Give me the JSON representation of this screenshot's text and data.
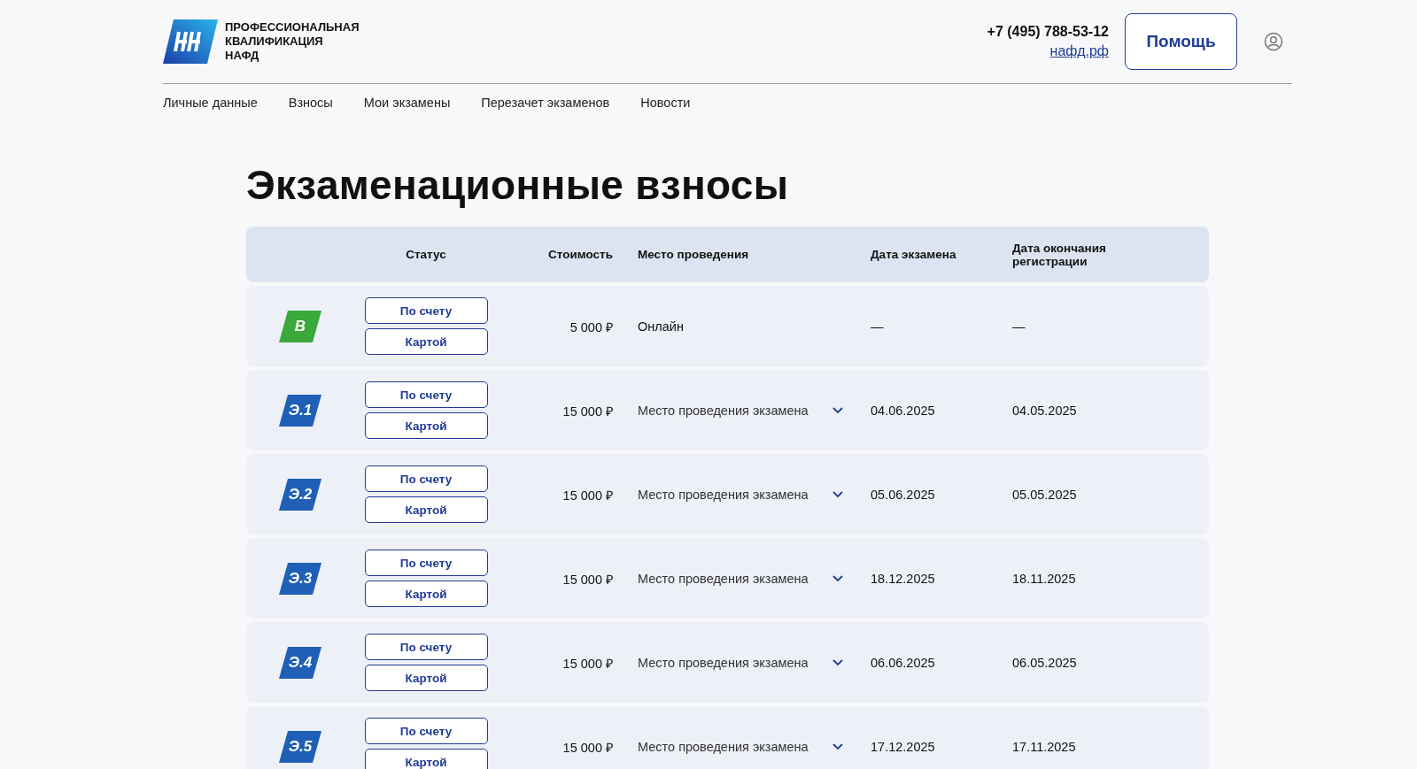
{
  "header": {
    "logo_text": [
      "ПРОФЕССИОНАЛЬНАЯ",
      "КВАЛИФИКАЦИЯ",
      "НАФД"
    ],
    "phone": "+7 (495) 788-53-12",
    "site_link": "нафд.рф",
    "help_button": "Помощь"
  },
  "nav": [
    {
      "label": "Личные данные"
    },
    {
      "label": "Взносы"
    },
    {
      "label": "Мои экзамены"
    },
    {
      "label": "Перезачет экзаменов"
    },
    {
      "label": "Новости"
    }
  ],
  "title": "Экзаменационные взносы",
  "table": {
    "columns": [
      "",
      "Статус",
      "Стоимость",
      "Место проведения",
      "Дата экзамена",
      "Дата окончания регистрации"
    ],
    "rows": [
      {
        "badge": "В",
        "color": "#3aa83a",
        "buttons": [
          "По счету",
          "Картой"
        ],
        "price": "5 000 ₽",
        "place": {
          "kind": "text",
          "text": "Онлайн"
        },
        "exam_date": "—",
        "reg_end": "—"
      },
      {
        "badge": "Э.1",
        "color": "#1f5fb5",
        "buttons": [
          "По счету",
          "Картой"
        ],
        "price": "15 000 ₽",
        "place": {
          "kind": "select",
          "text": "Место проведения экзамена"
        },
        "exam_date": "04.06.2025",
        "reg_end": "04.05.2025"
      },
      {
        "badge": "Э.2",
        "color": "#1f5fb5",
        "buttons": [
          "По счету",
          "Картой"
        ],
        "price": "15 000 ₽",
        "place": {
          "kind": "select",
          "text": "Место проведения экзамена"
        },
        "exam_date": "05.06.2025",
        "reg_end": "05.05.2025"
      },
      {
        "badge": "Э.3",
        "color": "#1f5fb5",
        "buttons": [
          "По счету",
          "Картой"
        ],
        "price": "15 000 ₽",
        "place": {
          "kind": "select",
          "text": "Место проведения экзамена"
        },
        "exam_date": "18.12.2025",
        "reg_end": "18.11.2025"
      },
      {
        "badge": "Э.4",
        "color": "#1f5fb5",
        "buttons": [
          "По счету",
          "Картой"
        ],
        "price": "15 000 ₽",
        "place": {
          "kind": "select",
          "text": "Место проведения экзамена"
        },
        "exam_date": "06.06.2025",
        "reg_end": "06.05.2025"
      },
      {
        "badge": "Э.5",
        "color": "#1f5fb5",
        "buttons": [
          "По счету",
          "Картой"
        ],
        "price": "15 000 ₽",
        "place": {
          "kind": "select",
          "text": "Место проведения экзамена"
        },
        "exam_date": "17.12.2025",
        "reg_end": "17.11.2025"
      }
    ]
  }
}
